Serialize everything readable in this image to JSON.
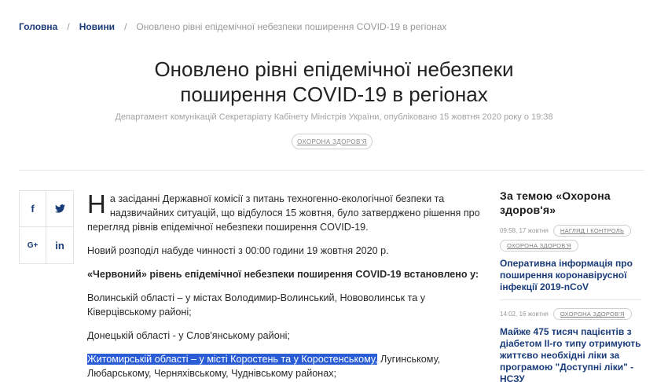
{
  "breadcrumb": {
    "home": "Головна",
    "news": "Новини",
    "current": "Оновлено рівні епідемічної небезпеки поширення COVID-19 в регіонах"
  },
  "title": {
    "line1": "Оновлено рівні епідемічної небезпеки",
    "line2": "поширення COVID-19 в регіонах"
  },
  "byline": "Департамент комунікацій Секретаріату Кабінету Міністрів України, опубліковано 15 жовтня 2020 року о 19:38",
  "tag": "Охорона здоров'я",
  "share": {
    "facebook": "f",
    "twitter": "🐦",
    "gplus": "G+",
    "linkedin": "in"
  },
  "article": {
    "dropcap": "Н",
    "p1": "а засіданні Державної комісії з питань техногенно-екологічної безпеки та надзвичайних ситуацій, що відбулося 15 жовтня, було затверджено рішення про перегляд рівнів епідемічної небезпеки поширення COVID-19.",
    "p2": "Новий розподіл набуде чинності з 00:00 години 19 жовтня 2020 р.",
    "p3_bold": "«Червоний»",
    "p3_rest": " рівень епідемічної небезпеки поширення COVID-19 встановлено у:",
    "p4": "Волинській області – у містах Володимир-Волинський, Нововолинськ та у Ківерцівському районі;",
    "p5": "Донецькій області - у Слов'янському районі;",
    "p6_highlight": "Житомирській області – у містi Коростень та у Коростенському,",
    "p6_rest": " Лугинському, Любарському, Черняхівському, Чуднівському районах;"
  },
  "aside": {
    "title": "За темою «Охорона здоров'я»",
    "items": [
      {
        "time": "09:58, 17 жовтня",
        "tags": [
          "Нагляд і контроль",
          "Охорона здоров'я"
        ],
        "link": "Оперативна інформація про поширення коронавірусної інфекції 2019-nCoV"
      },
      {
        "time": "14:02, 16 жовтня",
        "tags": [
          "Охорона здоров'я"
        ],
        "link": "Майже 475 тисяч пацієнтів з діабетом ІІ-го типу отримують життєво необхідні ліки за програмою \"Доступні ліки\" - НСЗУ"
      }
    ]
  }
}
